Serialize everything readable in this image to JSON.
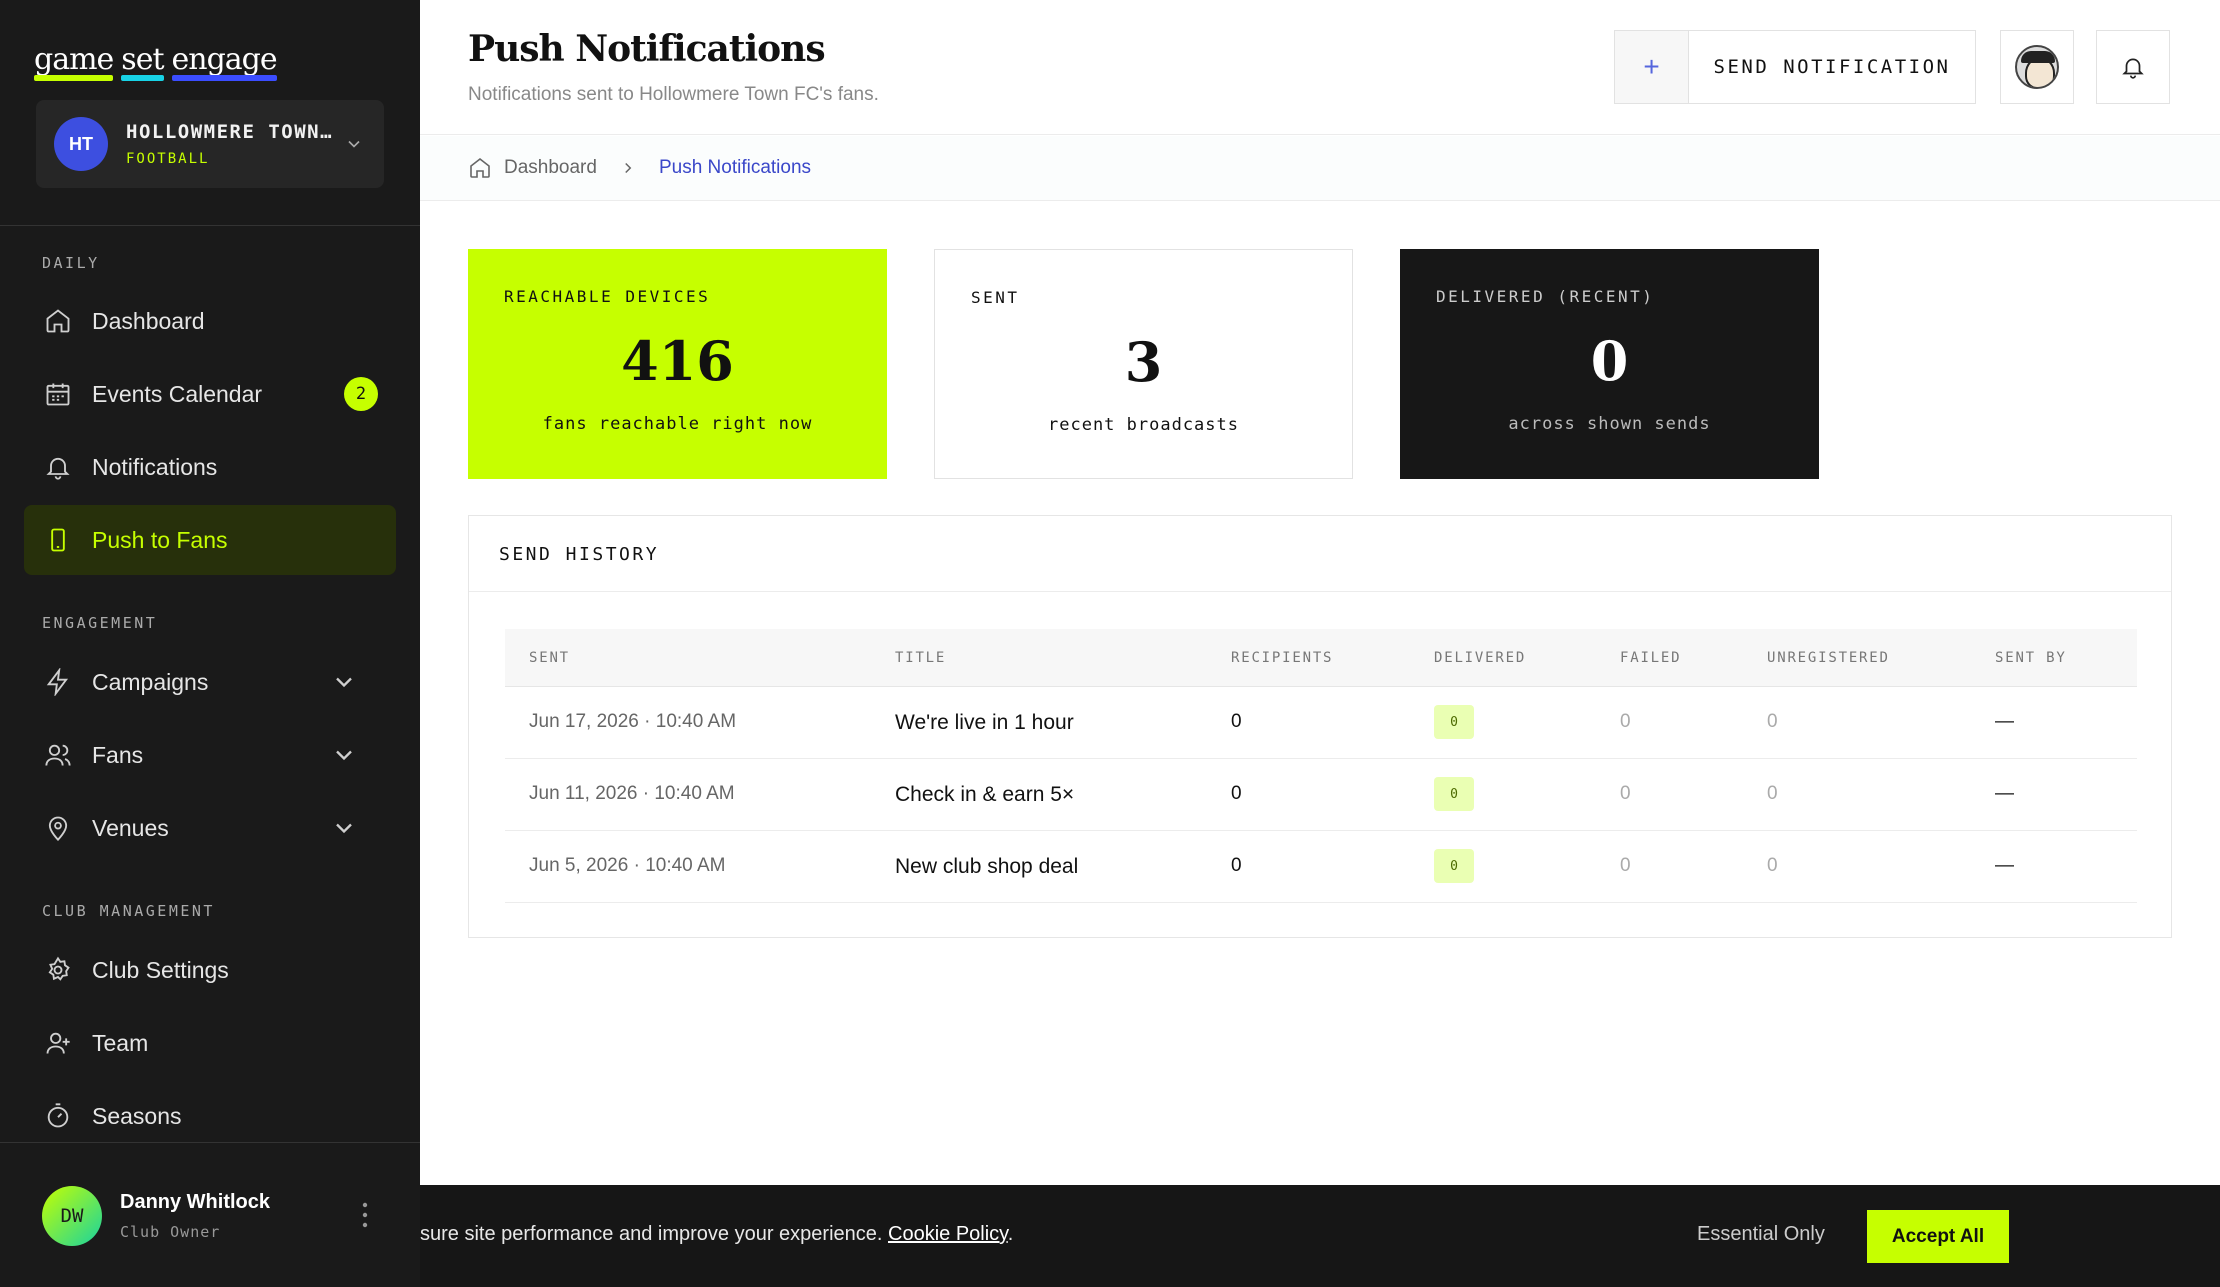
{
  "brand": {
    "words": [
      "game",
      "set",
      "engage"
    ],
    "colors": {
      "accent": "#c6ff00",
      "cyan": "#18d3e6",
      "blue": "#3b4dff"
    }
  },
  "club": {
    "initials": "HT",
    "name": "HOLLOWMERE TOWN…",
    "sport": "FOOTBALL"
  },
  "sidebar": {
    "sections": [
      {
        "label": "DAILY"
      },
      {
        "label": "ENGAGEMENT"
      },
      {
        "label": "CLUB MANAGEMENT"
      }
    ],
    "items": [
      {
        "label": "Dashboard",
        "icon": "home-icon"
      },
      {
        "label": "Events Calendar",
        "icon": "calendar-icon",
        "badge": "2"
      },
      {
        "label": "Notifications",
        "icon": "bell-icon"
      },
      {
        "label": "Push to Fans",
        "icon": "phone-icon",
        "active": true
      },
      {
        "label": "Campaigns",
        "icon": "lightning-icon"
      },
      {
        "label": "Fans",
        "icon": "users-icon"
      },
      {
        "label": "Venues",
        "icon": "map-pin-icon"
      },
      {
        "label": "Club Settings",
        "icon": "gear-icon"
      },
      {
        "label": "Team",
        "icon": "user-plus-icon"
      },
      {
        "label": "Seasons",
        "icon": "stopwatch-icon"
      }
    ]
  },
  "user": {
    "initials": "DW",
    "name": "Danny Whitlock",
    "role": "Club Owner"
  },
  "header": {
    "title": "Push Notifications",
    "subtitle": "Notifications sent to Hollowmere Town FC's fans.",
    "send_plus": "+",
    "send_label": "SEND NOTIFICATION"
  },
  "breadcrumb": {
    "home": "Dashboard",
    "current": "Push Notifications"
  },
  "stats": [
    {
      "label": "REACHABLE DEVICES",
      "value": "416",
      "caption": "fans reachable right now"
    },
    {
      "label": "SENT",
      "value": "3",
      "caption": "recent broadcasts"
    },
    {
      "label": "DELIVERED (RECENT)",
      "value": "0",
      "caption": "across shown sends"
    }
  ],
  "history": {
    "title": "SEND HISTORY",
    "columns": [
      "SENT",
      "TITLE",
      "RECIPIENTS",
      "DELIVERED",
      "FAILED",
      "UNREGISTERED",
      "SENT BY"
    ],
    "rows": [
      {
        "sent": "Jun 17, 2026 · 10:40 AM",
        "title": "We're live in 1 hour",
        "recipients": "0",
        "delivered": "0",
        "failed": "0",
        "unregistered": "0",
        "sent_by": "—"
      },
      {
        "sent": "Jun 11, 2026 · 10:40 AM",
        "title": "Check in & earn 5×",
        "recipients": "0",
        "delivered": "0",
        "failed": "0",
        "unregistered": "0",
        "sent_by": "—"
      },
      {
        "sent": "Jun 5, 2026 · 10:40 AM",
        "title": "New club shop deal",
        "recipients": "0",
        "delivered": "0",
        "failed": "0",
        "unregistered": "0",
        "sent_by": "—"
      }
    ]
  },
  "cookie": {
    "text": "sure site performance and improve your experience. ",
    "link": "Cookie Policy",
    "after_link": ".",
    "essential": "Essential Only",
    "accept": "Accept All"
  }
}
